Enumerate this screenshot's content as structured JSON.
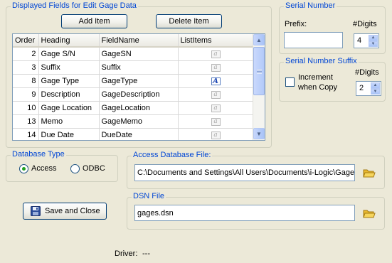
{
  "fields_group": {
    "title": "Displayed Fields for Edit Gage Data",
    "add_label": "Add Item",
    "delete_label": "Delete Item",
    "columns": [
      "Order",
      "Heading",
      "FieldName",
      "ListItems"
    ],
    "rows": [
      {
        "order": "2",
        "heading": "Gage S/N",
        "field": "GageSN",
        "list_icon": "list-items-icon",
        "active": false
      },
      {
        "order": "3",
        "heading": "Suffix",
        "field": "Suffix",
        "list_icon": "list-items-icon",
        "active": false
      },
      {
        "order": "8",
        "heading": "Gage Type",
        "field": "GageType",
        "list_icon": "list-items-active-icon",
        "active": true
      },
      {
        "order": "9",
        "heading": "Description",
        "field": "GageDescription",
        "list_icon": "list-items-icon",
        "active": false
      },
      {
        "order": "10",
        "heading": "Gage Location",
        "field": "GageLocation",
        "list_icon": "list-items-icon",
        "active": false
      },
      {
        "order": "13",
        "heading": "Memo",
        "field": "GageMemo",
        "list_icon": "list-items-icon",
        "active": false
      },
      {
        "order": "14",
        "heading": "Due Date",
        "field": "DueDate",
        "list_icon": "list-items-icon",
        "active": false
      }
    ]
  },
  "serial_number": {
    "title": "Serial Number",
    "prefix_label": "Prefix:",
    "prefix_value": "",
    "digits_label": "#Digits",
    "digits_value": "4"
  },
  "serial_suffix": {
    "title": "Serial Number Suffix",
    "digits_label": "#Digits",
    "increment_label_1": "Increment",
    "increment_label_2": "when Copy",
    "increment_checked": false,
    "digits_value": "2"
  },
  "database_type": {
    "title": "Database Type",
    "options": [
      "Access",
      "ODBC"
    ],
    "selected": "Access"
  },
  "access_file": {
    "title": "Access Database File:",
    "value": "C:\\Documents and Settings\\All Users\\Documents\\i-Logic\\GageC"
  },
  "dsn_file": {
    "title": "DSN File",
    "value": "gages.dsn"
  },
  "save_close_label": "Save and Close",
  "driver": {
    "label": "Driver:",
    "value": "---"
  },
  "colors": {
    "background": "#ece9d8",
    "group_title": "#0046d5",
    "button_border": "#003c74",
    "radio_selected": "#21a121",
    "folder": "#e8b830"
  },
  "icons": [
    "list-items-icon",
    "list-items-active-icon",
    "scroll-up-icon",
    "scroll-down-icon",
    "spin-up-icon",
    "spin-down-icon",
    "folder-icon",
    "floppy-disk-icon"
  ]
}
